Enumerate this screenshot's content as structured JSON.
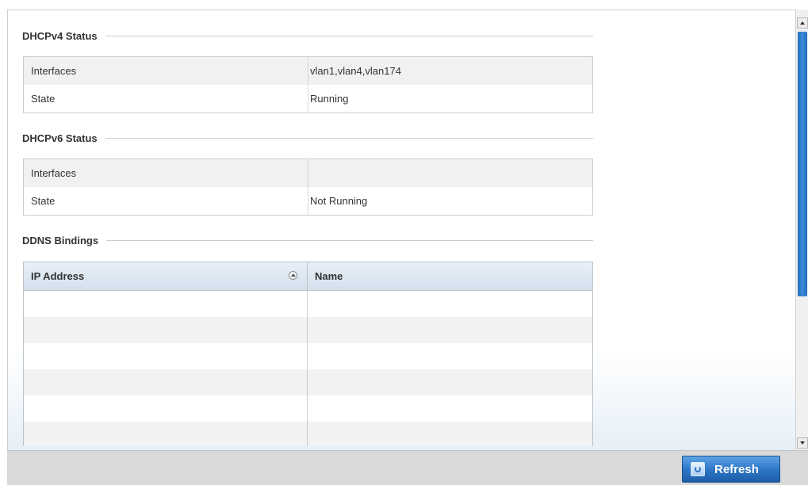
{
  "dhcpv4": {
    "title": "DHCPv4 Status",
    "rows": [
      {
        "label": "Interfaces",
        "value": "vlan1,vlan4,vlan174"
      },
      {
        "label": "State",
        "value": "Running"
      }
    ]
  },
  "dhcpv6": {
    "title": "DHCPv6 Status",
    "rows": [
      {
        "label": "Interfaces",
        "value": ""
      },
      {
        "label": "State",
        "value": "Not Running"
      }
    ]
  },
  "ddns": {
    "title": "DDNS Bindings",
    "columns": [
      "IP Address",
      "Name"
    ],
    "sort_icon": "sort-ascending-icon"
  },
  "footer": {
    "refresh_label": "Refresh",
    "refresh_icon": "refresh-icon"
  },
  "colors": {
    "accent": "#2a74c4",
    "scroll_thumb": "#1f6ec0",
    "footer_bg": "#d9d9d9"
  }
}
